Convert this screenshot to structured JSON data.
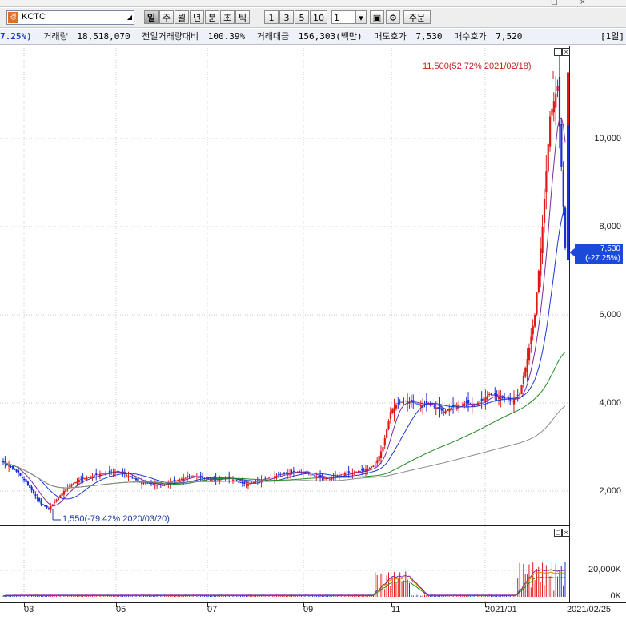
{
  "toolbar": {
    "stock_badge": "경",
    "stock_name": "KCTC",
    "period_buttons": [
      "일",
      "주",
      "월",
      "년",
      "분",
      "초",
      "틱"
    ],
    "active_period": "일",
    "n_buttons": [
      "1",
      "3",
      "5",
      "10"
    ],
    "n_input_value": "1",
    "order_button": "주문"
  },
  "infobar": {
    "change_pct": "7.25%)",
    "volume_label": "거래량",
    "volume_value": "18,518,070",
    "prev_volume_ratio_label": "전일거래량대비",
    "prev_volume_ratio_value": "100.39%",
    "trade_amount_label": "거래대금",
    "trade_amount_value": "156,303(백만)",
    "ask_label": "매도호가",
    "ask_value": "7,530",
    "bid_label": "매수호가",
    "bid_value": "7,520",
    "interval_badge": "[1일]"
  },
  "price_pane": {
    "y_labels": [
      "10,000",
      "8,000",
      "6,000",
      "4,000",
      "2,000"
    ],
    "high_annotation": "11,500(52.72% 2021/02/18)",
    "low_annotation": "1,550(-79.42% 2020/03/20)",
    "current_price": "7,530",
    "current_change": "(-27.25%)"
  },
  "volume_pane": {
    "y_labels": [
      "20,000K",
      "0K"
    ]
  },
  "x_axis": {
    "labels": [
      "03",
      "05",
      "07",
      "09",
      "11",
      "2021/01",
      "2021/02/25"
    ]
  },
  "chart_data": {
    "type": "candlestick",
    "title": "KCTC",
    "interval": "1일",
    "ylim": [
      1400,
      12000
    ],
    "x_labels": [
      "03",
      "05",
      "07",
      "09",
      "11",
      "2021/01"
    ],
    "series_close": [
      2650,
      2550,
      2400,
      2200,
      1950,
      1700,
      1600,
      1800,
      2000,
      2150,
      2250,
      2300,
      2350,
      2400,
      2420,
      2450,
      2380,
      2300,
      2200,
      2180,
      2150,
      2120,
      2200,
      2250,
      2300,
      2350,
      2300,
      2280,
      2250,
      2300,
      2280,
      2200,
      2150,
      2200,
      2250,
      2300,
      2350,
      2400,
      2420,
      2450,
      2400,
      2350,
      2300,
      2280,
      2350,
      2400,
      2420,
      2450,
      2500,
      2600,
      3000,
      3800,
      4000,
      4050,
      4000,
      3950,
      4000,
      3900,
      3800,
      3900,
      3950,
      4000,
      3950,
      4050,
      4200,
      4150,
      4100,
      4050,
      4200,
      5000,
      6000,
      8000,
      10500,
      11200,
      7530
    ],
    "annotations": {
      "high": {
        "price": 11500,
        "pct": 52.72,
        "date": "2021/02/18"
      },
      "low": {
        "price": 1550,
        "pct": -79.42,
        "date": "2020/03/20"
      }
    },
    "last": {
      "price": 7530,
      "change_pct": -27.25
    },
    "volume_ylim": [
      0,
      30000
    ]
  }
}
